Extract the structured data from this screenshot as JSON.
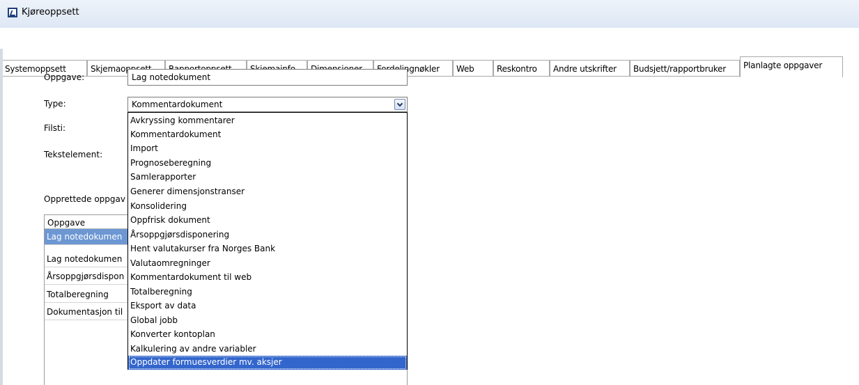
{
  "window": {
    "title": "Kjøreoppsett"
  },
  "tabs": [
    "Systemoppsett",
    "Skjemaoppsett",
    "Rapportoppsett",
    "Skjemainfo",
    "Dimensjoner",
    "Fordelingnøkler",
    "Web",
    "Reskontro",
    "Andre utskrifter",
    "Budsjett/rapportbruker",
    "Planlagte oppgaver"
  ],
  "active_tab": "Planlagte oppgaver",
  "form": {
    "oppgave_label": "Oppgave:",
    "oppgave_value": "Lag notedokument",
    "type_label": "Type:",
    "type_value": "Kommentardokument",
    "filsti_label": "Filsti:",
    "tekstelement_label": "Tekstelement:"
  },
  "task_list": {
    "caption": "Opprettede oppgav",
    "header": "Oppgave",
    "rows": [
      "Lag notedokumen",
      "Lag notedokumen",
      "Årsoppgjørsdispon",
      "Totalberegning",
      "Dokumentasjon til"
    ],
    "selected_index": 0
  },
  "dropdown": {
    "options": [
      "Avkryssing kommentarer",
      "Kommentardokument",
      "Import",
      "Prognoseberegning",
      "Samlerapporter",
      "Generer dimensjonstranser",
      "Konsolidering",
      "Oppfrisk dokument",
      "Årsoppgjørsdisponering",
      "Hent valutakurser fra Norges Bank",
      "Valutaomregninger",
      "Kommentardokument til web",
      "Totalberegning",
      "Eksport av data",
      "Global jobb",
      "Konverter kontoplan",
      "Kalkulering av andre variabler",
      "Oppdater formuesverdier mv. aksjer"
    ],
    "highlighted": "Oppdater formuesverdier mv. aksjer"
  }
}
